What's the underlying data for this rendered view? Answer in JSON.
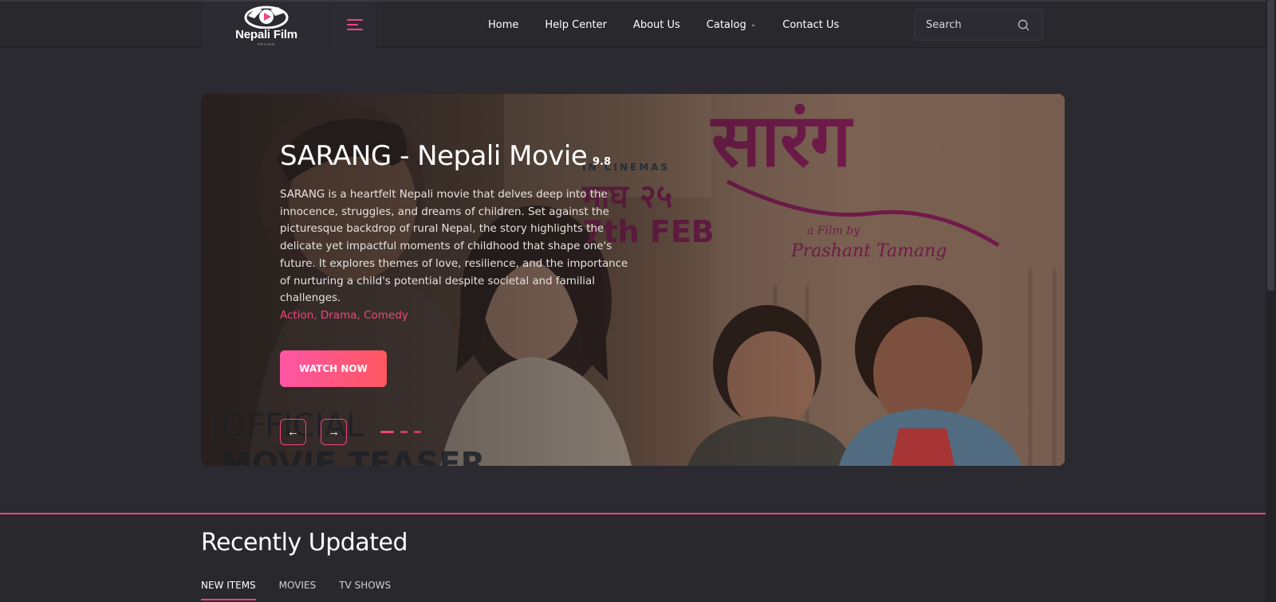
{
  "header": {
    "logo_text": "Nepali Film",
    "logo_sub": "REVIEW",
    "nav": [
      {
        "label": "Home"
      },
      {
        "label": "Help Center"
      },
      {
        "label": "About Us"
      },
      {
        "label": "Catalog",
        "has_dropdown": true
      },
      {
        "label": "Contact Us"
      }
    ],
    "search_placeholder": "Search"
  },
  "hero": {
    "title": "SARANG - Nepali Movie",
    "rating": "9.8",
    "description": "SARANG is a heartfelt Nepali movie that delves deep into the innocence, struggles, and dreams of children. Set against the picturesque backdrop of rural Nepal, the story highlights the delicate yet impactful moments of childhood that shape one's future. It explores themes of love, resilience, and the importance of nurturing a child's potential despite societal and familial challenges.",
    "genres": "Action, Drama, Comedy",
    "watch_label": "WATCH NOW",
    "poster": {
      "title_devanagari": "सारंग",
      "in_cinemas": "IN CINEMAS",
      "date_devanagari": "माघ २५",
      "date_english": "7th FEB",
      "film_by": "a Film by",
      "director": "Prashant Tamang",
      "teaser": "OFFICIAL",
      "teaser2": "MOVIE TEASER"
    },
    "slides": 3,
    "active_slide": 1
  },
  "section": {
    "title": "Recently Updated",
    "tabs": [
      {
        "label": "NEW ITEMS",
        "active": true
      },
      {
        "label": "MOVIES",
        "active": false
      },
      {
        "label": "TV SHOWS",
        "active": false
      }
    ]
  },
  "colors": {
    "accent": "#f0447e",
    "background": "#2b2a30",
    "header": "#29282d",
    "button_from": "#ff55a5",
    "button_to": "#ff5860"
  },
  "icons": {
    "search": "search-icon",
    "menu": "hamburger-icon",
    "prev": "arrow-left-icon",
    "next": "arrow-right-icon",
    "dropdown": "chevron-down-icon"
  }
}
